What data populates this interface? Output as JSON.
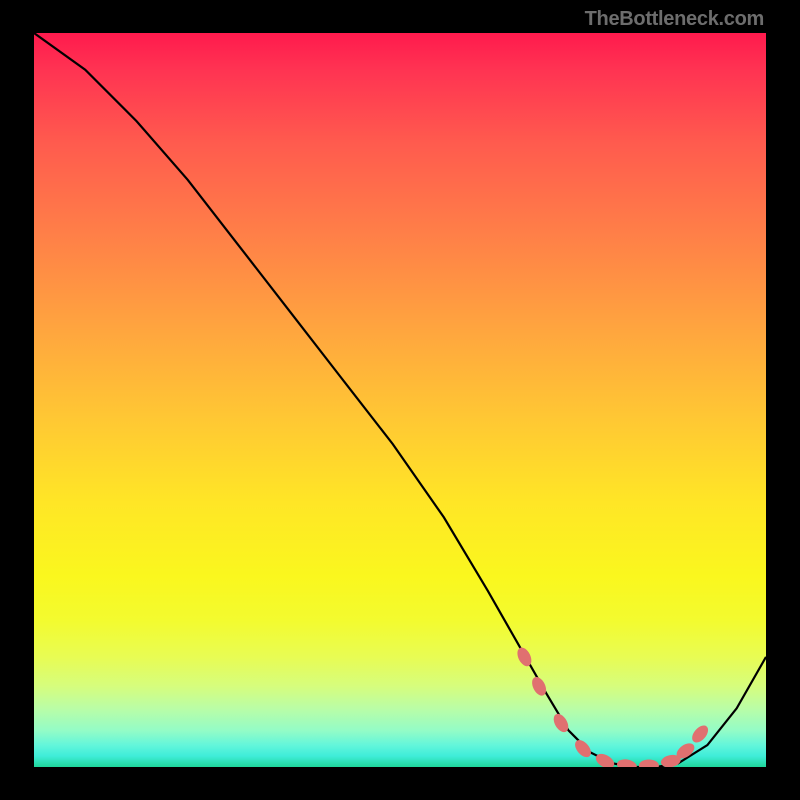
{
  "watermark": "TheBottleneck.com",
  "chart_data": {
    "type": "line",
    "xlim": [
      0,
      100
    ],
    "ylim": [
      0,
      100
    ],
    "series": [
      {
        "name": "bottleneck-curve",
        "x": [
          0,
          7,
          14,
          21,
          28,
          35,
          42,
          49,
          56,
          62,
          66,
          70,
          73,
          76,
          79,
          82,
          85,
          88,
          92,
          96,
          100
        ],
        "values": [
          100,
          95,
          88,
          80,
          71,
          62,
          53,
          44,
          34,
          24,
          17,
          10,
          5,
          2,
          0.5,
          0,
          0,
          0.5,
          3,
          8,
          15
        ]
      }
    ],
    "markers": {
      "name": "highlighted-range",
      "x": [
        67,
        69,
        72,
        75,
        78,
        81,
        84,
        87,
        89,
        91
      ],
      "values": [
        15,
        11,
        6,
        2.5,
        0.8,
        0.2,
        0.2,
        0.8,
        2.2,
        4.5
      ]
    },
    "title": "",
    "xlabel": "",
    "ylabel": ""
  },
  "colors": {
    "curve": "#000000",
    "marker_fill": "#e07070",
    "marker_stroke": "#c75a5a"
  }
}
